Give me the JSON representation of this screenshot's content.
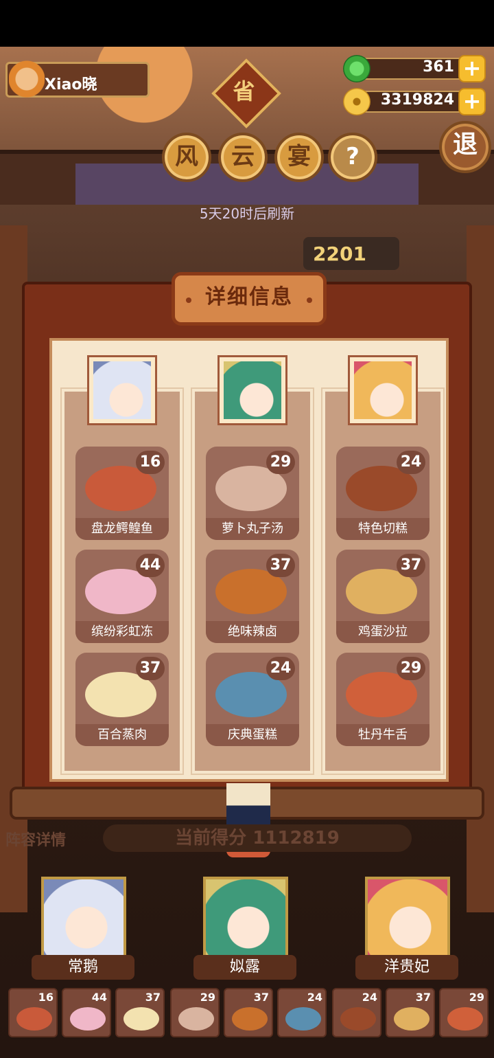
{
  "user": {
    "name": "Xiao晓"
  },
  "currency": {
    "jade": "361",
    "coins": "3319824",
    "plus": "+"
  },
  "header": {
    "badge": "省",
    "title_chars": [
      "风",
      "云",
      "宴"
    ],
    "help": "?",
    "exit": "退",
    "refresh_text": "5天20时后刷新",
    "score_partial": "2201"
  },
  "modal": {
    "title": "详细信息",
    "columns": [
      {
        "dishes": [
          {
            "name": "盘龙鳄鳇鱼",
            "count": "16",
            "color": "#c95a3a"
          },
          {
            "name": "缤纷彩虹冻",
            "count": "44",
            "color": "#f0b7c8"
          },
          {
            "name": "百合蒸肉",
            "count": "37",
            "color": "#f3e2b0"
          }
        ]
      },
      {
        "dishes": [
          {
            "name": "萝卜丸子汤",
            "count": "29",
            "color": "#d9b4a0"
          },
          {
            "name": "绝味辣卤",
            "count": "37",
            "color": "#c9702c"
          },
          {
            "name": "庆典蛋糕",
            "count": "24",
            "color": "#5a8fb0"
          }
        ]
      },
      {
        "dishes": [
          {
            "name": "特色切糕",
            "count": "24",
            "color": "#9a4a2a"
          },
          {
            "name": "鸡蛋沙拉",
            "count": "37",
            "color": "#e0b060"
          },
          {
            "name": "牡丹牛舌",
            "count": "29",
            "color": "#d0603a"
          }
        ]
      }
    ]
  },
  "bottom": {
    "lineup_label": "阵容详情",
    "current_score": "当前得分 1112819",
    "characters": [
      "常鹅",
      "姒露",
      "洋贵妃"
    ],
    "dish_bar": [
      "16",
      "44",
      "37",
      "29",
      "37",
      "24",
      "24",
      "37",
      "29"
    ]
  }
}
